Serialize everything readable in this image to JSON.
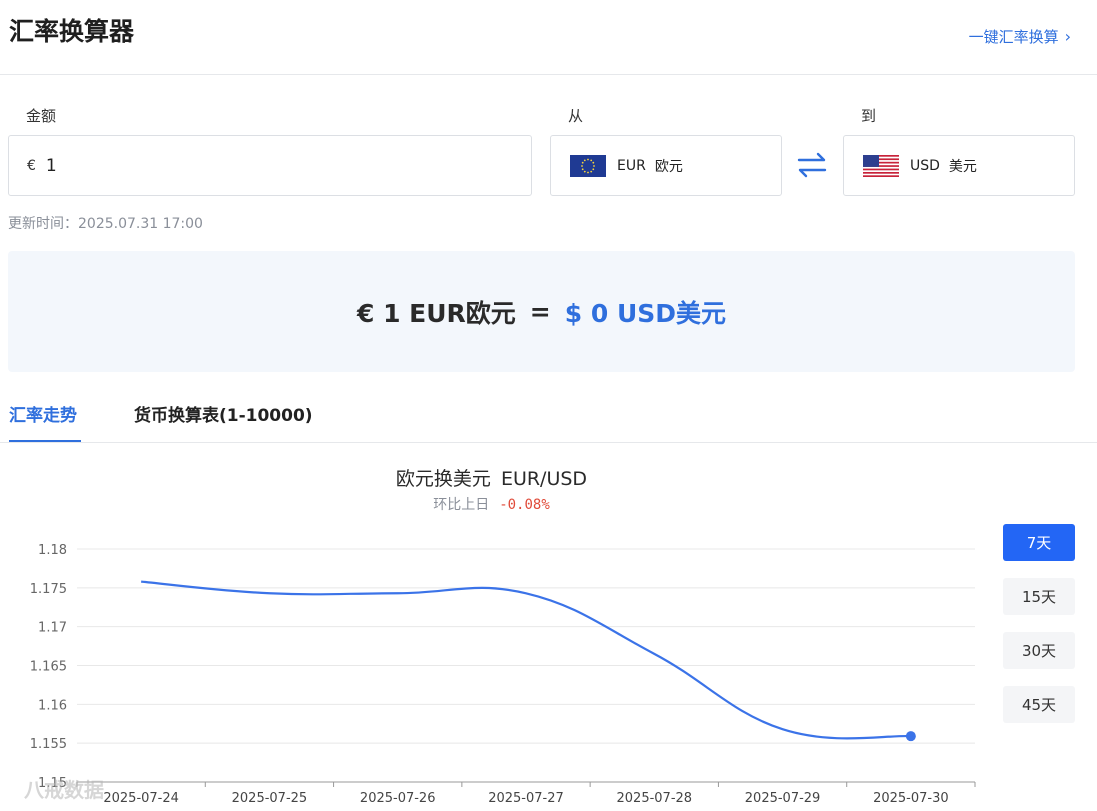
{
  "header": {
    "title": "汇率换算器",
    "quick_link": "一键汇率换算"
  },
  "form": {
    "amount_label": "金额",
    "amount_symbol": "€",
    "amount_value": "1",
    "from_label": "从",
    "from_code": "EUR",
    "from_name": "欧元",
    "to_label": "到",
    "to_code": "USD",
    "to_name": "美元"
  },
  "update_time": "更新时间：2025.07.31 17:00",
  "result": {
    "lhs": "€ 1 EUR欧元",
    "eq": "=",
    "rhs": "$ 0 USD美元"
  },
  "tabs": {
    "trend": "汇率走势",
    "table": "货币换算表(1-10000)"
  },
  "chart_header": {
    "title": "欧元换美元",
    "pair": "EUR/USD",
    "change_label": "环比上日",
    "change_value": "-0.08%"
  },
  "ranges": [
    "7天",
    "15天",
    "30天",
    "45天"
  ],
  "watermark": "八戒数据",
  "colors": {
    "accent": "#2f6fdd",
    "line": "#3b73e8",
    "negative": "#e04b3a"
  },
  "chart_data": {
    "type": "line",
    "x": [
      "2025-07-24",
      "2025-07-25",
      "2025-07-26",
      "2025-07-27",
      "2025-07-28",
      "2025-07-29",
      "2025-07-30"
    ],
    "series": [
      {
        "values": [
          1.1758,
          1.1743,
          1.1743,
          1.1743,
          1.1665,
          1.1568,
          1.1559
        ]
      }
    ],
    "ylim": [
      1.15,
      1.18
    ],
    "yticks": [
      "1.15",
      "1.155",
      "1.16",
      "1.165",
      "1.17",
      "1.175",
      "1.18"
    ],
    "grid": true
  }
}
